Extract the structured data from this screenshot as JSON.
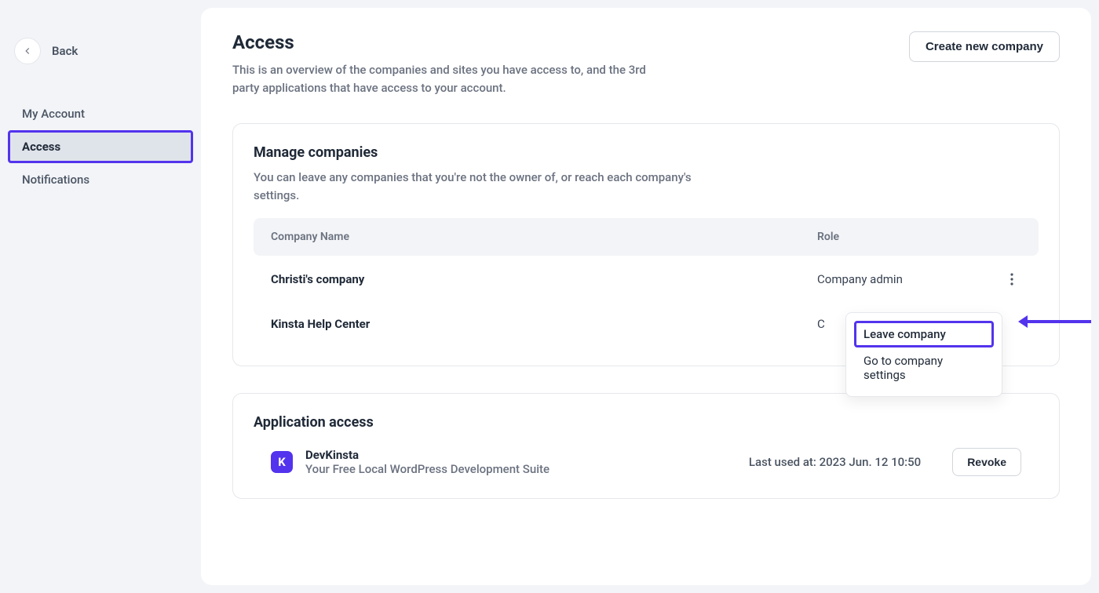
{
  "sidebar": {
    "back_label": "Back",
    "items": [
      {
        "label": "My Account"
      },
      {
        "label": "Access"
      },
      {
        "label": "Notifications"
      }
    ]
  },
  "header": {
    "title": "Access",
    "subtitle": "This is an overview of the companies and sites you have access to, and the 3rd party applications that have access to your account.",
    "create_button": "Create new company"
  },
  "companies_panel": {
    "title": "Manage companies",
    "desc": "You can leave any companies that you're not the owner of, or reach each company's settings.",
    "col_name": "Company Name",
    "col_role": "Role",
    "rows": [
      {
        "name": "Christi's company",
        "role": "Company admin"
      },
      {
        "name": "Kinsta Help Center",
        "role": "C"
      }
    ],
    "dropdown": {
      "leave": "Leave company",
      "settings": "Go to company settings"
    }
  },
  "apps_panel": {
    "title": "Application access",
    "app": {
      "icon_letter": "K",
      "name": "DevKinsta",
      "desc": "Your Free Local WordPress Development Suite",
      "last_used": "Last used at: 2023 Jun. 12 10:50",
      "revoke": "Revoke"
    }
  }
}
